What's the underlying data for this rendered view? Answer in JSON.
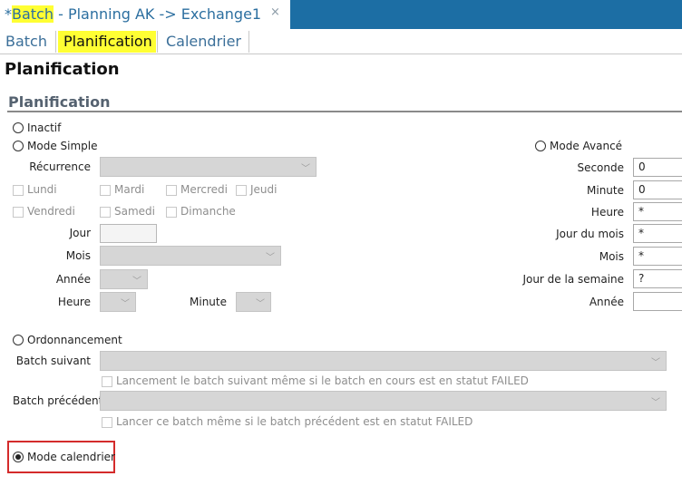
{
  "doc_tab": {
    "prefix": "*",
    "highlight": "Batch",
    "rest": " - Planning AK -> Exchange1",
    "close_glyph": "×"
  },
  "tabs": [
    {
      "label": "Batch",
      "active": false
    },
    {
      "label": "Planification",
      "active": true
    },
    {
      "label": "Calendrier",
      "active": false
    }
  ],
  "page_title": "Planification",
  "section_title": "Planification",
  "radios": {
    "inactif": {
      "label": "Inactif",
      "checked": false
    },
    "mode_simple": {
      "label": "Mode Simple",
      "checked": false
    },
    "mode_avance": {
      "label": "Mode Avancé",
      "checked": false
    },
    "ordonnancement": {
      "label": "Ordonnancement",
      "checked": false
    },
    "mode_calendrier": {
      "label": "Mode calendrier",
      "checked": true
    }
  },
  "simple": {
    "recurrence_label": "Récurrence",
    "days": [
      "Lundi",
      "Mardi",
      "Mercredi",
      "Jeudi",
      "Vendredi",
      "Samedi",
      "Dimanche"
    ],
    "jour_label": "Jour",
    "mois_label": "Mois",
    "annee_label": "Année",
    "heure_label": "Heure",
    "minute_label": "Minute"
  },
  "avance": {
    "seconde": {
      "label": "Seconde",
      "value": "0"
    },
    "minute": {
      "label": "Minute",
      "value": "0"
    },
    "heure": {
      "label": "Heure",
      "value": "*"
    },
    "jour_du_mois": {
      "label": "Jour du mois",
      "value": "*"
    },
    "mois": {
      "label": "Mois",
      "value": "*"
    },
    "jour_semaine": {
      "label": "Jour de la semaine",
      "value": "?"
    },
    "annee": {
      "label": "Année",
      "value": ""
    }
  },
  "ordo": {
    "batch_suivant_label": "Batch suivant",
    "suivant_check_label": "Lancement le batch suivant même si le batch en cours est en statut FAILED",
    "batch_precedent_label": "Batch précédent",
    "precedent_check_label": "Lancer ce batch même si le batch précédent est en statut FAILED"
  },
  "icons": {
    "chevron": "﹀"
  },
  "colors": {
    "title_bar": "#1c6ea4",
    "highlight": "#ffff33",
    "callout": "#d42b2b",
    "tab_text": "#3b6f99"
  }
}
